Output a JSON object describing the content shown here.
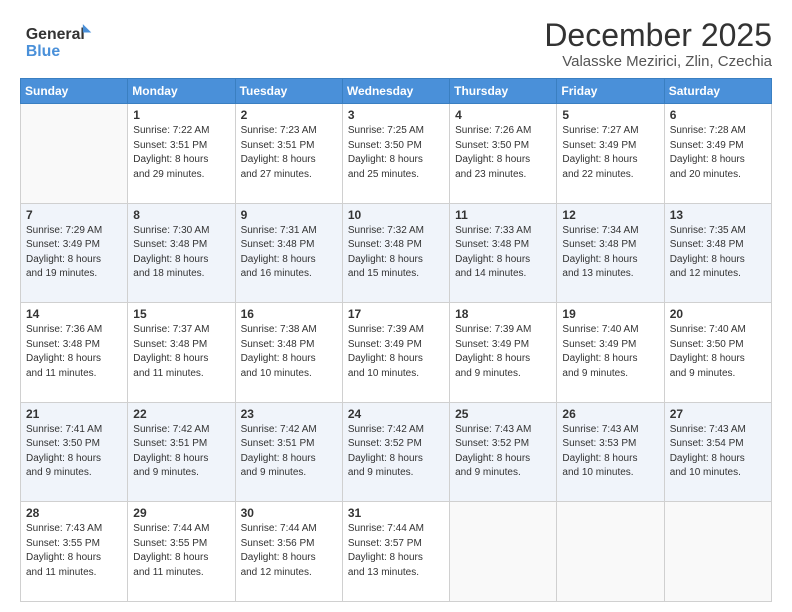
{
  "logo": {
    "line1": "General",
    "line2": "Blue"
  },
  "title": "December 2025",
  "subtitle": "Valasske Mezirici, Zlin, Czechia",
  "days_of_week": [
    "Sunday",
    "Monday",
    "Tuesday",
    "Wednesday",
    "Thursday",
    "Friday",
    "Saturday"
  ],
  "weeks": [
    [
      {
        "day": "",
        "info": ""
      },
      {
        "day": "1",
        "info": "Sunrise: 7:22 AM\nSunset: 3:51 PM\nDaylight: 8 hours\nand 29 minutes."
      },
      {
        "day": "2",
        "info": "Sunrise: 7:23 AM\nSunset: 3:51 PM\nDaylight: 8 hours\nand 27 minutes."
      },
      {
        "day": "3",
        "info": "Sunrise: 7:25 AM\nSunset: 3:50 PM\nDaylight: 8 hours\nand 25 minutes."
      },
      {
        "day": "4",
        "info": "Sunrise: 7:26 AM\nSunset: 3:50 PM\nDaylight: 8 hours\nand 23 minutes."
      },
      {
        "day": "5",
        "info": "Sunrise: 7:27 AM\nSunset: 3:49 PM\nDaylight: 8 hours\nand 22 minutes."
      },
      {
        "day": "6",
        "info": "Sunrise: 7:28 AM\nSunset: 3:49 PM\nDaylight: 8 hours\nand 20 minutes."
      }
    ],
    [
      {
        "day": "7",
        "info": "Sunrise: 7:29 AM\nSunset: 3:49 PM\nDaylight: 8 hours\nand 19 minutes."
      },
      {
        "day": "8",
        "info": "Sunrise: 7:30 AM\nSunset: 3:48 PM\nDaylight: 8 hours\nand 18 minutes."
      },
      {
        "day": "9",
        "info": "Sunrise: 7:31 AM\nSunset: 3:48 PM\nDaylight: 8 hours\nand 16 minutes."
      },
      {
        "day": "10",
        "info": "Sunrise: 7:32 AM\nSunset: 3:48 PM\nDaylight: 8 hours\nand 15 minutes."
      },
      {
        "day": "11",
        "info": "Sunrise: 7:33 AM\nSunset: 3:48 PM\nDaylight: 8 hours\nand 14 minutes."
      },
      {
        "day": "12",
        "info": "Sunrise: 7:34 AM\nSunset: 3:48 PM\nDaylight: 8 hours\nand 13 minutes."
      },
      {
        "day": "13",
        "info": "Sunrise: 7:35 AM\nSunset: 3:48 PM\nDaylight: 8 hours\nand 12 minutes."
      }
    ],
    [
      {
        "day": "14",
        "info": "Sunrise: 7:36 AM\nSunset: 3:48 PM\nDaylight: 8 hours\nand 11 minutes."
      },
      {
        "day": "15",
        "info": "Sunrise: 7:37 AM\nSunset: 3:48 PM\nDaylight: 8 hours\nand 11 minutes."
      },
      {
        "day": "16",
        "info": "Sunrise: 7:38 AM\nSunset: 3:48 PM\nDaylight: 8 hours\nand 10 minutes."
      },
      {
        "day": "17",
        "info": "Sunrise: 7:39 AM\nSunset: 3:49 PM\nDaylight: 8 hours\nand 10 minutes."
      },
      {
        "day": "18",
        "info": "Sunrise: 7:39 AM\nSunset: 3:49 PM\nDaylight: 8 hours\nand 9 minutes."
      },
      {
        "day": "19",
        "info": "Sunrise: 7:40 AM\nSunset: 3:49 PM\nDaylight: 8 hours\nand 9 minutes."
      },
      {
        "day": "20",
        "info": "Sunrise: 7:40 AM\nSunset: 3:50 PM\nDaylight: 8 hours\nand 9 minutes."
      }
    ],
    [
      {
        "day": "21",
        "info": "Sunrise: 7:41 AM\nSunset: 3:50 PM\nDaylight: 8 hours\nand 9 minutes."
      },
      {
        "day": "22",
        "info": "Sunrise: 7:42 AM\nSunset: 3:51 PM\nDaylight: 8 hours\nand 9 minutes."
      },
      {
        "day": "23",
        "info": "Sunrise: 7:42 AM\nSunset: 3:51 PM\nDaylight: 8 hours\nand 9 minutes."
      },
      {
        "day": "24",
        "info": "Sunrise: 7:42 AM\nSunset: 3:52 PM\nDaylight: 8 hours\nand 9 minutes."
      },
      {
        "day": "25",
        "info": "Sunrise: 7:43 AM\nSunset: 3:52 PM\nDaylight: 8 hours\nand 9 minutes."
      },
      {
        "day": "26",
        "info": "Sunrise: 7:43 AM\nSunset: 3:53 PM\nDaylight: 8 hours\nand 10 minutes."
      },
      {
        "day": "27",
        "info": "Sunrise: 7:43 AM\nSunset: 3:54 PM\nDaylight: 8 hours\nand 10 minutes."
      }
    ],
    [
      {
        "day": "28",
        "info": "Sunrise: 7:43 AM\nSunset: 3:55 PM\nDaylight: 8 hours\nand 11 minutes."
      },
      {
        "day": "29",
        "info": "Sunrise: 7:44 AM\nSunset: 3:55 PM\nDaylight: 8 hours\nand 11 minutes."
      },
      {
        "day": "30",
        "info": "Sunrise: 7:44 AM\nSunset: 3:56 PM\nDaylight: 8 hours\nand 12 minutes."
      },
      {
        "day": "31",
        "info": "Sunrise: 7:44 AM\nSunset: 3:57 PM\nDaylight: 8 hours\nand 13 minutes."
      },
      {
        "day": "",
        "info": ""
      },
      {
        "day": "",
        "info": ""
      },
      {
        "day": "",
        "info": ""
      }
    ]
  ]
}
